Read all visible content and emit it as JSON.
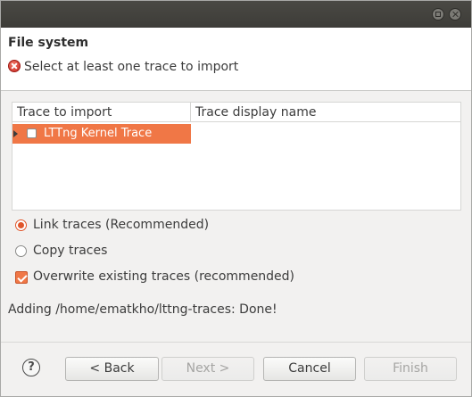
{
  "header": {
    "title": "File system",
    "message": "Select at least one trace to import"
  },
  "table": {
    "columns": [
      "Trace to import",
      "Trace display name"
    ],
    "rows": [
      {
        "label": "LTTng Kernel Trace",
        "display_name": "",
        "checked": false
      }
    ]
  },
  "options": {
    "link_traces": {
      "label": "Link traces (Recommended)",
      "selected": true
    },
    "copy_traces": {
      "label": "Copy traces",
      "selected": false
    },
    "overwrite": {
      "label": "Overwrite existing traces (recommended)",
      "checked": true
    }
  },
  "status": "Adding /home/ematkho/lttng-traces: Done!",
  "buttons": {
    "help": "?",
    "back": "< Back",
    "next": "Next >",
    "cancel": "Cancel",
    "finish": "Finish"
  },
  "colors": {
    "accent": "#f07746",
    "error": "#c9251e",
    "titlebar": "#3d3c38"
  }
}
